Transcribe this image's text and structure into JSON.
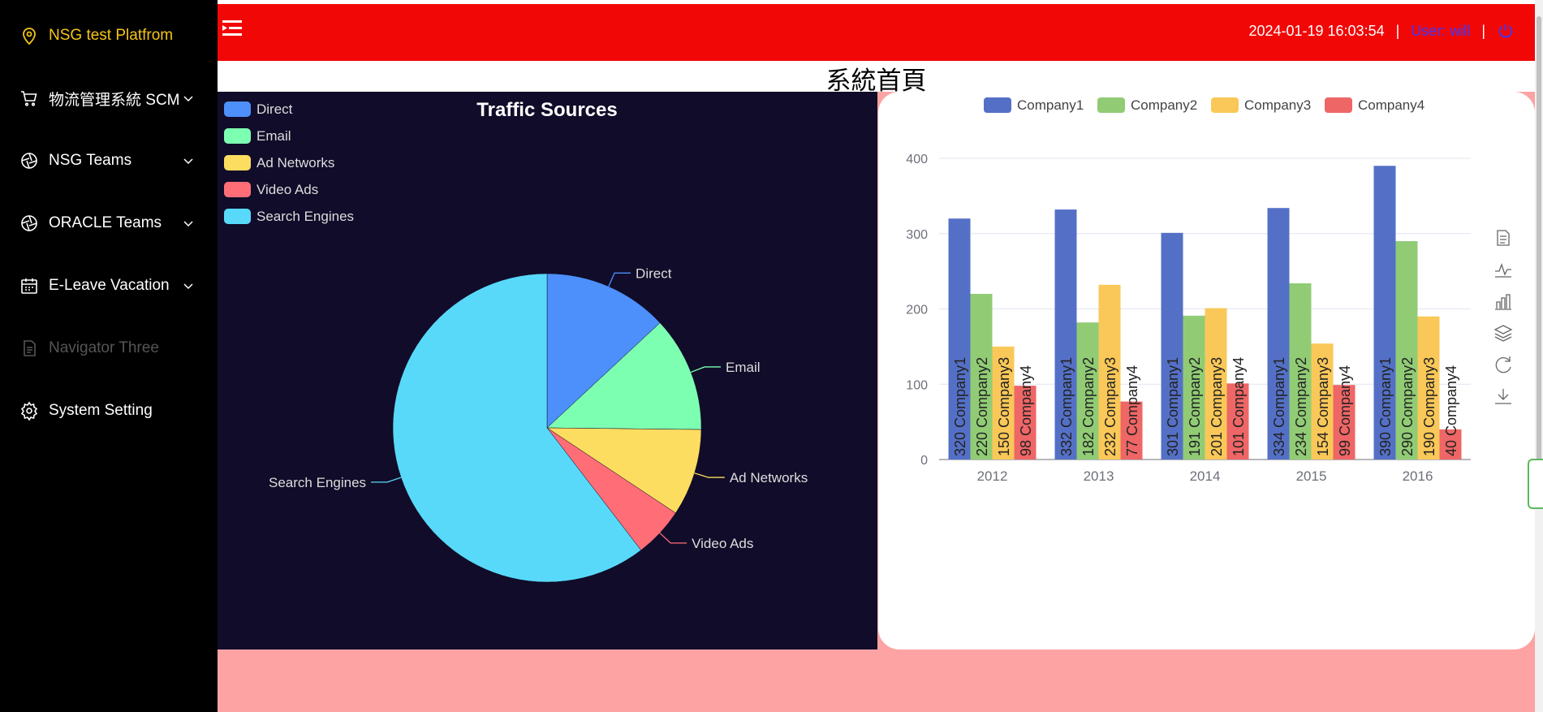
{
  "sidebar": {
    "brand": "NSG test Platfrom",
    "items": [
      {
        "label": "物流管理系統 SCM",
        "icon": "cart-icon"
      },
      {
        "label": "NSG Teams",
        "icon": "aperture-icon"
      },
      {
        "label": "ORACLE Teams",
        "icon": "aperture-icon"
      },
      {
        "label": "E-Leave Vacation",
        "icon": "calendar-icon"
      },
      {
        "label": "Navigator Three",
        "icon": "document-icon"
      },
      {
        "label": "System Setting",
        "icon": "gear-icon"
      }
    ]
  },
  "header": {
    "datetime": "2024-01-19 16:03:54",
    "separator": "|",
    "user": "User: will",
    "power_icon": "power-icon",
    "menu_icon": "menu-fold-icon"
  },
  "page": {
    "title": "系統首頁"
  },
  "colors": {
    "header_bg": "#f20707",
    "sidebar_bg": "#000000",
    "brand": "#f5c518",
    "pie_bg": "#100c29",
    "page_bg": "#fda3a3"
  },
  "toolbox": {
    "icons": [
      "data-view-icon",
      "line-chart-icon",
      "bar-chart-icon",
      "stack-icon",
      "restore-icon",
      "download-icon"
    ]
  },
  "chart_data": [
    {
      "type": "pie",
      "title": "Traffic Sources",
      "legend_position": "top-left",
      "categories": [
        "Direct",
        "Email",
        "Ad Networks",
        "Video Ads",
        "Search Engines"
      ],
      "values": [
        335,
        310,
        234,
        135,
        1548
      ],
      "colors": [
        "#4d8ffb",
        "#7dffb2",
        "#fddd60",
        "#ff6e76",
        "#58d9f9"
      ]
    },
    {
      "type": "bar",
      "title": "",
      "legend_position": "top-center",
      "categories": [
        "2012",
        "2013",
        "2014",
        "2015",
        "2016"
      ],
      "series": [
        {
          "name": "Company1",
          "color": "#5470c6",
          "values": [
            320,
            332,
            301,
            334,
            390
          ]
        },
        {
          "name": "Company2",
          "color": "#91cc75",
          "values": [
            220,
            182,
            191,
            234,
            290
          ]
        },
        {
          "name": "Company3",
          "color": "#fac858",
          "values": [
            150,
            232,
            201,
            154,
            190
          ]
        },
        {
          "name": "Company4",
          "color": "#ee6666",
          "values": [
            98,
            77,
            101,
            99,
            40
          ]
        }
      ],
      "ylim": [
        0,
        400
      ],
      "yticks": [
        0,
        100,
        200,
        300,
        400
      ],
      "grid": true
    }
  ]
}
